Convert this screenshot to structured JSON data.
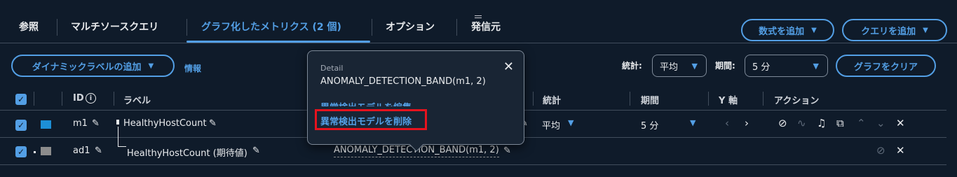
{
  "tabs": [
    {
      "label": "参照"
    },
    {
      "label": "マルチソースクエリ"
    },
    {
      "label": "グラフ化したメトリクス (2 個)"
    },
    {
      "label": "オプション"
    },
    {
      "label": "発信元"
    }
  ],
  "buttons": {
    "add_math": "数式を追加",
    "add_query": "クエリを追加",
    "add_dynamic_label": "ダイナミックラベルの追加",
    "clear_graph": "グラフをクリア"
  },
  "info_link": "情報",
  "controls": {
    "stat_label": "統計:",
    "stat_value": "平均",
    "period_label": "期間:",
    "period_value": "5 分"
  },
  "table": {
    "headers": {
      "id": "ID",
      "label": "ラベル",
      "stat": "統計",
      "period": "期間",
      "y_axis": "Y 軸",
      "actions": "アクション"
    },
    "rows": [
      {
        "id": "m1",
        "label": "HealthyHostCount",
        "stat": "平均",
        "period": "5 分",
        "color": "#1d8fd6"
      },
      {
        "id": "ad1",
        "label": "HealthyHostCount (期待値)",
        "details": "ANOMALY_DETECTION_BAND(m1, 2)",
        "color": "#8c8c8c"
      }
    ]
  },
  "popover": {
    "header": "Detail",
    "expression": "ANOMALY_DETECTION_BAND(m1, 2)",
    "edit_model": "異常検出モデルを編集",
    "delete_model": "異常検出モデルを削除"
  },
  "colors": {
    "accent": "#539fe5",
    "background": "#0f1b2a",
    "highlight": "#e6131e"
  }
}
